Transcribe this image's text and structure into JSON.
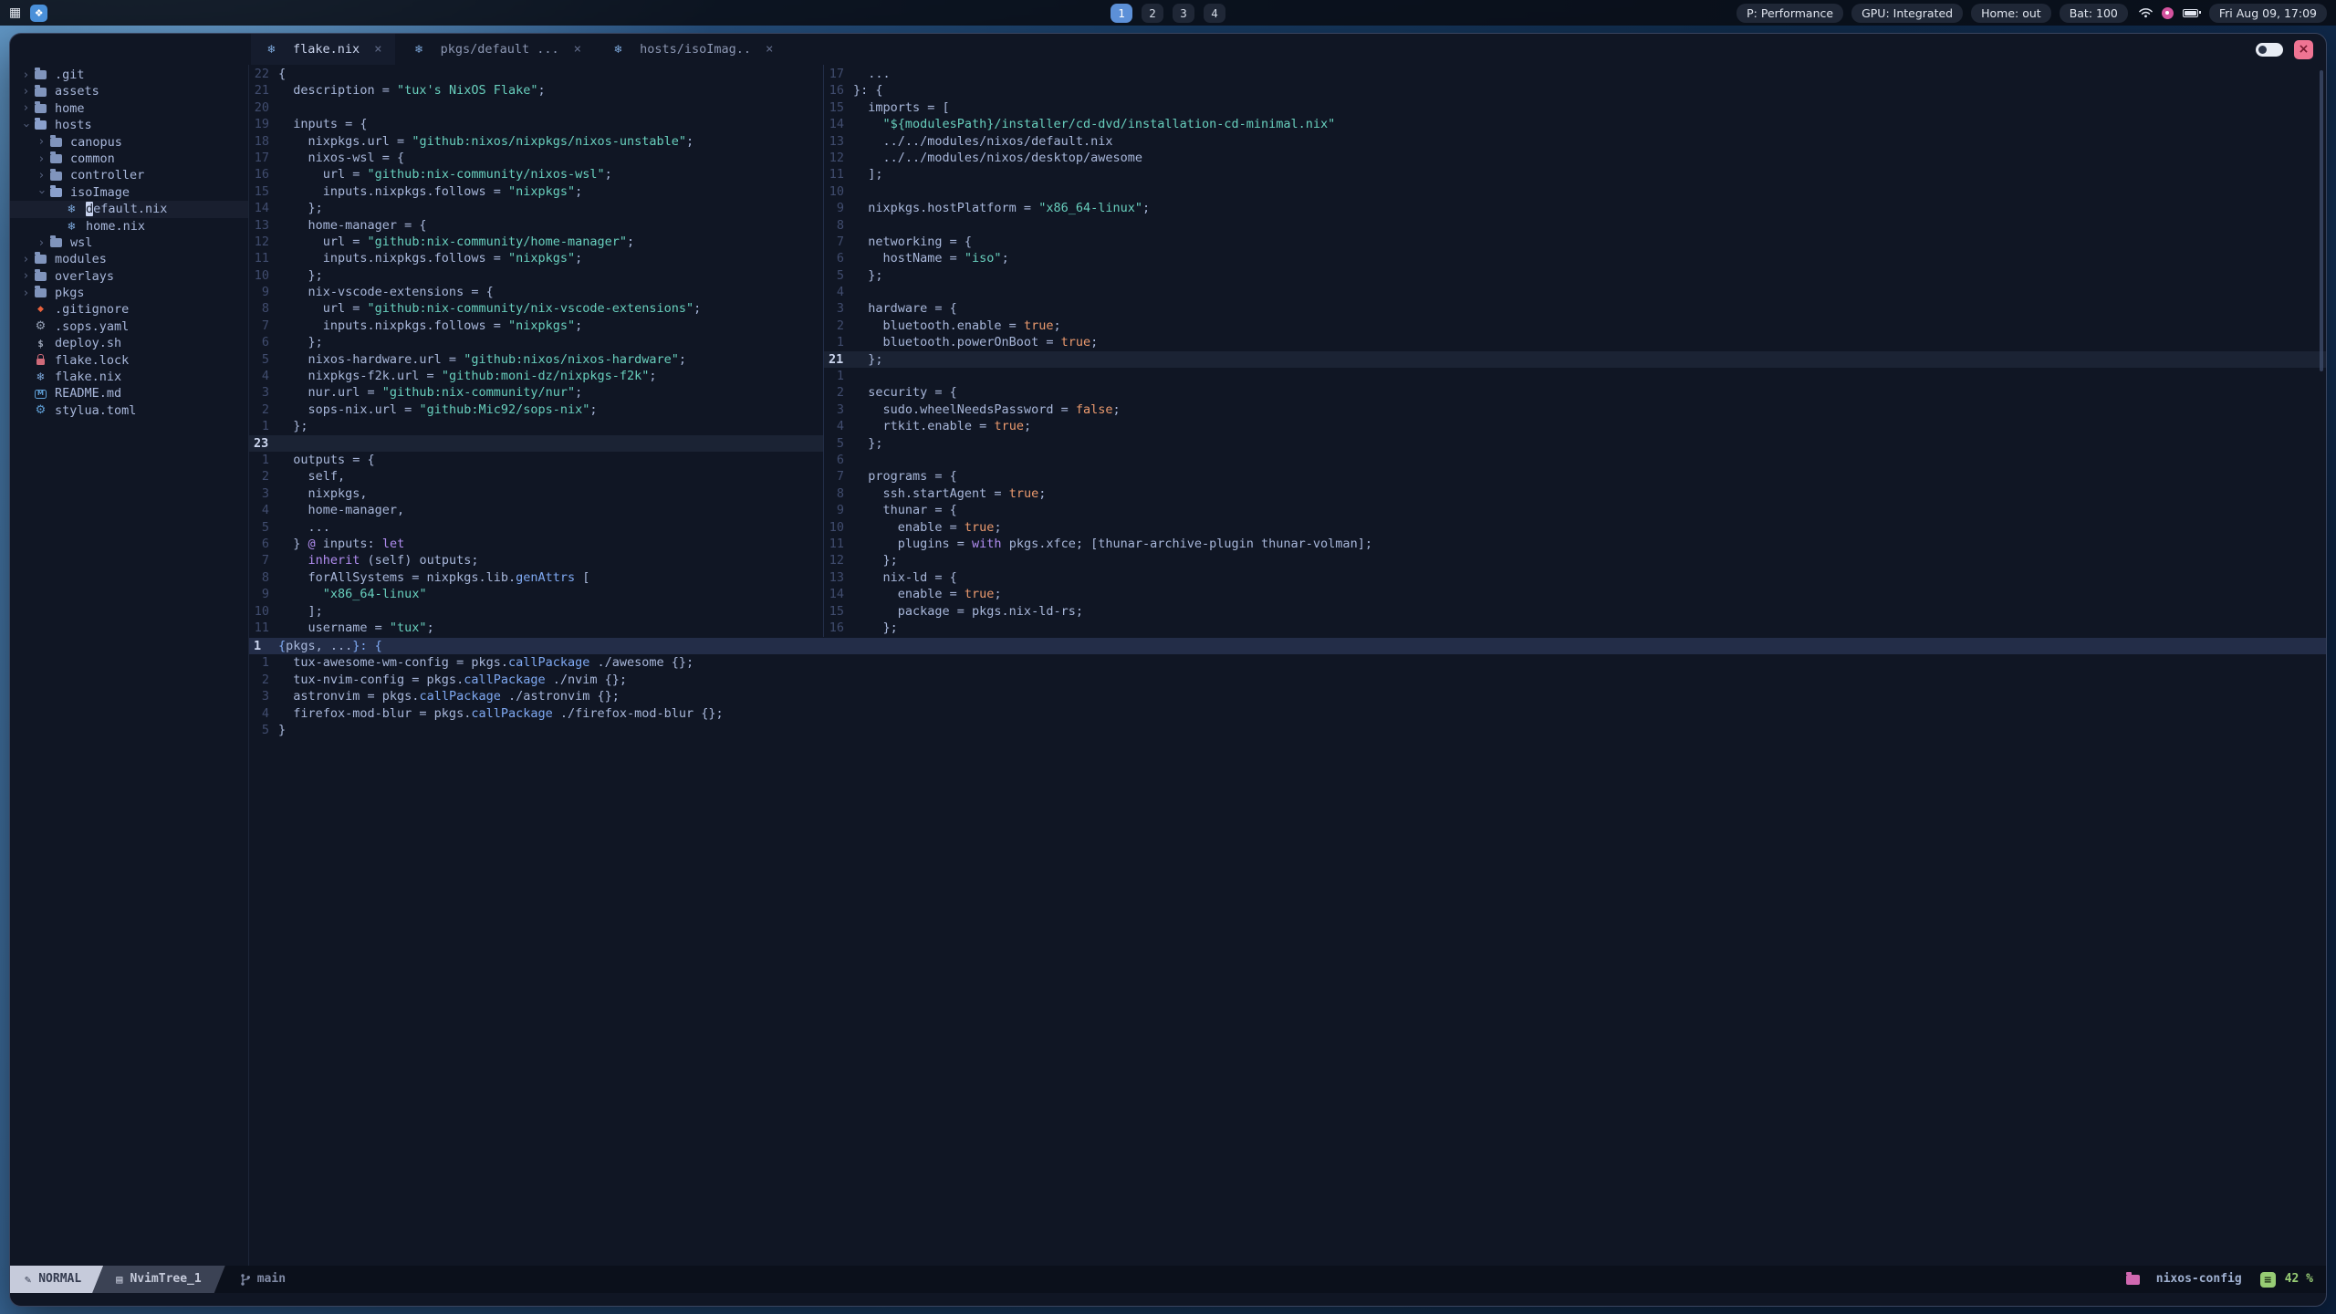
{
  "topbar": {
    "workspaces": [
      "1",
      "2",
      "3",
      "4"
    ],
    "active_workspace": "1",
    "pills": [
      "P: Performance",
      "GPU: Integrated",
      "Home: out",
      "Bat: 100"
    ],
    "clock": "Fri Aug 09, 17:09",
    "left_icons": [
      "app-grid",
      "launcher"
    ],
    "right_icons": [
      "wifi",
      "notification",
      "battery"
    ]
  },
  "window": {
    "tabs": [
      {
        "icon": "nix",
        "label": "flake.nix",
        "active": true
      },
      {
        "icon": "nix",
        "label": "pkgs/default ...",
        "active": false
      },
      {
        "icon": "nix",
        "label": "hosts/isoImag..",
        "active": false
      }
    ],
    "controls": {
      "toggle": "pin-toggle",
      "close": "×"
    }
  },
  "tree": {
    "items": [
      {
        "indent": 0,
        "chevron": "right",
        "icon": "folder",
        "label": ".git"
      },
      {
        "indent": 0,
        "chevron": "right",
        "icon": "folder",
        "label": "assets"
      },
      {
        "indent": 0,
        "chevron": "right",
        "icon": "folder",
        "label": "home"
      },
      {
        "indent": 0,
        "chevron": "down",
        "icon": "folder-open",
        "label": "hosts"
      },
      {
        "indent": 1,
        "chevron": "right",
        "icon": "folder",
        "label": "canopus"
      },
      {
        "indent": 1,
        "chevron": "right",
        "icon": "folder",
        "label": "common"
      },
      {
        "indent": 1,
        "chevron": "right",
        "icon": "folder",
        "label": "controller"
      },
      {
        "indent": 1,
        "chevron": "down",
        "icon": "folder-open",
        "label": "isoImage"
      },
      {
        "indent": 2,
        "chevron": "none",
        "icon": "nix",
        "label": "default.nix",
        "cursor": true
      },
      {
        "indent": 2,
        "chevron": "none",
        "icon": "nix",
        "label": "home.nix"
      },
      {
        "indent": 1,
        "chevron": "right",
        "icon": "folder",
        "label": "wsl"
      },
      {
        "indent": 0,
        "chevron": "right",
        "icon": "folder",
        "label": "modules"
      },
      {
        "indent": 0,
        "chevron": "right",
        "icon": "folder",
        "label": "overlays"
      },
      {
        "indent": 0,
        "chevron": "right",
        "icon": "folder",
        "label": "pkgs"
      },
      {
        "indent": 0,
        "chevron": "none",
        "icon": "git",
        "label": ".gitignore"
      },
      {
        "indent": 0,
        "chevron": "none",
        "icon": "gear",
        "label": ".sops.yaml"
      },
      {
        "indent": 0,
        "chevron": "none",
        "icon": "script",
        "label": "deploy.sh"
      },
      {
        "indent": 0,
        "chevron": "none",
        "icon": "lock",
        "label": "flake.lock"
      },
      {
        "indent": 0,
        "chevron": "none",
        "icon": "nix",
        "label": "flake.nix"
      },
      {
        "indent": 0,
        "chevron": "none",
        "icon": "markdown",
        "label": "README.md"
      },
      {
        "indent": 0,
        "chevron": "none",
        "icon": "gear-blue",
        "label": "stylua.toml"
      }
    ]
  },
  "panes": {
    "flake": {
      "lines": [
        {
          "n": "22",
          "s": [
            [
              "{",
              "f"
            ]
          ]
        },
        {
          "n": "21",
          "s": [
            [
              "  description = ",
              "f"
            ],
            [
              "\"tux's NixOS Flake\"",
              "s"
            ],
            [
              ";",
              "f"
            ]
          ]
        },
        {
          "n": "20",
          "s": []
        },
        {
          "n": "19",
          "s": [
            [
              "  inputs = {",
              "f"
            ]
          ]
        },
        {
          "n": "18",
          "s": [
            [
              "    nixpkgs.url = ",
              "f"
            ],
            [
              "\"github:nixos/nixpkgs/nixos-unstable\"",
              "s"
            ],
            [
              ";",
              "f"
            ]
          ]
        },
        {
          "n": "17",
          "s": [
            [
              "    nixos-wsl = {",
              "f"
            ]
          ]
        },
        {
          "n": "16",
          "s": [
            [
              "      url = ",
              "f"
            ],
            [
              "\"github:nix-community/nixos-wsl\"",
              "s"
            ],
            [
              ";",
              "f"
            ]
          ]
        },
        {
          "n": "15",
          "s": [
            [
              "      inputs.nixpkgs.follows = ",
              "f"
            ],
            [
              "\"nixpkgs\"",
              "s"
            ],
            [
              ";",
              "f"
            ]
          ]
        },
        {
          "n": "14",
          "s": [
            [
              "    };",
              "f"
            ]
          ]
        },
        {
          "n": "13",
          "s": [
            [
              "    home-manager = {",
              "f"
            ]
          ]
        },
        {
          "n": "12",
          "s": [
            [
              "      url = ",
              "f"
            ],
            [
              "\"github:nix-community/home-manager\"",
              "s"
            ],
            [
              ";",
              "f"
            ]
          ]
        },
        {
          "n": "11",
          "s": [
            [
              "      inputs.nixpkgs.follows = ",
              "f"
            ],
            [
              "\"nixpkgs\"",
              "s"
            ],
            [
              ";",
              "f"
            ]
          ]
        },
        {
          "n": "10",
          "s": [
            [
              "    };",
              "f"
            ]
          ]
        },
        {
          "n": "9",
          "s": [
            [
              "    nix-vscode-extensions = {",
              "f"
            ]
          ]
        },
        {
          "n": "8",
          "s": [
            [
              "      url = ",
              "f"
            ],
            [
              "\"github:nix-community/nix-vscode-extensions\"",
              "s"
            ],
            [
              ";",
              "f"
            ]
          ]
        },
        {
          "n": "7",
          "s": [
            [
              "      inputs.nixpkgs.follows = ",
              "f"
            ],
            [
              "\"nixpkgs\"",
              "s"
            ],
            [
              ";",
              "f"
            ]
          ]
        },
        {
          "n": "6",
          "s": [
            [
              "    };",
              "f"
            ]
          ]
        },
        {
          "n": "5",
          "s": [
            [
              "    nixos-hardware.url = ",
              "f"
            ],
            [
              "\"github:nixos/nixos-hardware\"",
              "s"
            ],
            [
              ";",
              "f"
            ]
          ]
        },
        {
          "n": "4",
          "s": [
            [
              "    nixpkgs-f2k.url = ",
              "f"
            ],
            [
              "\"github:moni-dz/nixpkgs-f2k\"",
              "s"
            ],
            [
              ";",
              "f"
            ]
          ]
        },
        {
          "n": "3",
          "s": [
            [
              "    nur.url = ",
              "f"
            ],
            [
              "\"github:nix-community/nur\"",
              "s"
            ],
            [
              ";",
              "f"
            ]
          ]
        },
        {
          "n": "2",
          "s": [
            [
              "    sops-nix.url = ",
              "f"
            ],
            [
              "\"github:Mic92/sops-nix\"",
              "s"
            ],
            [
              ";",
              "f"
            ]
          ]
        },
        {
          "n": "1",
          "s": [
            [
              "  };",
              "f"
            ]
          ]
        },
        {
          "n": "23",
          "cur": true,
          "s": []
        },
        {
          "n": "1",
          "s": [
            [
              "  outputs = {",
              "f"
            ]
          ]
        },
        {
          "n": "2",
          "s": [
            [
              "    self,",
              "f"
            ]
          ]
        },
        {
          "n": "3",
          "s": [
            [
              "    nixpkgs,",
              "f"
            ]
          ]
        },
        {
          "n": "4",
          "s": [
            [
              "    home-manager,",
              "f"
            ]
          ]
        },
        {
          "n": "5",
          "s": [
            [
              "    ...",
              "f"
            ]
          ]
        },
        {
          "n": "6",
          "s": [
            [
              "  } ",
              "f"
            ],
            [
              "@",
              "k"
            ],
            [
              " inputs: ",
              "f"
            ],
            [
              "let",
              "k"
            ]
          ]
        },
        {
          "n": "7",
          "s": [
            [
              "    ",
              "f"
            ],
            [
              "inherit",
              "k"
            ],
            [
              " (self) outputs;",
              "f"
            ]
          ]
        },
        {
          "n": "8",
          "s": [
            [
              "    forAllSystems = nixpkgs.lib.",
              "f"
            ],
            [
              "genAttrs",
              "u"
            ],
            [
              " [",
              "f"
            ]
          ]
        },
        {
          "n": "9",
          "s": [
            [
              "      ",
              "f"
            ],
            [
              "\"x86_64-linux\"",
              "s"
            ]
          ]
        },
        {
          "n": "10",
          "s": [
            [
              "    ];",
              "f"
            ]
          ]
        },
        {
          "n": "11",
          "s": [
            [
              "    username = ",
              "f"
            ],
            [
              "\"tux\"",
              "s"
            ],
            [
              ";",
              "f"
            ]
          ]
        }
      ]
    },
    "iso": {
      "lines": [
        {
          "n": "17",
          "s": [
            [
              "  ...",
              "f"
            ]
          ]
        },
        {
          "n": "16",
          "s": [
            [
              "}: {",
              "f"
            ]
          ]
        },
        {
          "n": "15",
          "s": [
            [
              "  imports = [",
              "f"
            ]
          ]
        },
        {
          "n": "14",
          "s": [
            [
              "    ",
              "f"
            ],
            [
              "\"${modulesPath}/installer/cd-dvd/installation-cd-minimal.nix\"",
              "s"
            ]
          ]
        },
        {
          "n": "13",
          "s": [
            [
              "    ../../modules/nixos/default.nix",
              "f"
            ]
          ]
        },
        {
          "n": "12",
          "s": [
            [
              "    ../../modules/nixos/desktop/awesome",
              "f"
            ]
          ]
        },
        {
          "n": "11",
          "s": [
            [
              "  ];",
              "f"
            ]
          ]
        },
        {
          "n": "10",
          "s": []
        },
        {
          "n": "9",
          "s": [
            [
              "  nixpkgs.hostPlatform = ",
              "f"
            ],
            [
              "\"x86_64-linux\"",
              "s"
            ],
            [
              ";",
              "f"
            ]
          ]
        },
        {
          "n": "8",
          "s": []
        },
        {
          "n": "7",
          "s": [
            [
              "  networking = {",
              "f"
            ]
          ]
        },
        {
          "n": "6",
          "s": [
            [
              "    hostName = ",
              "f"
            ],
            [
              "\"iso\"",
              "s"
            ],
            [
              ";",
              "f"
            ]
          ]
        },
        {
          "n": "5",
          "s": [
            [
              "  };",
              "f"
            ]
          ]
        },
        {
          "n": "4",
          "s": []
        },
        {
          "n": "3",
          "s": [
            [
              "  hardware = {",
              "f"
            ]
          ]
        },
        {
          "n": "2",
          "s": [
            [
              "    bluetooth.enable = ",
              "f"
            ],
            [
              "true",
              "b"
            ],
            [
              ";",
              "f"
            ]
          ]
        },
        {
          "n": "1",
          "s": [
            [
              "    bluetooth.powerOnBoot = ",
              "f"
            ],
            [
              "true",
              "b"
            ],
            [
              ";",
              "f"
            ]
          ]
        },
        {
          "n": "21",
          "cur": true,
          "s": [
            [
              "  };",
              "f"
            ]
          ]
        },
        {
          "n": "1",
          "s": []
        },
        {
          "n": "2",
          "s": [
            [
              "  security = {",
              "f"
            ]
          ]
        },
        {
          "n": "3",
          "s": [
            [
              "    sudo.wheelNeedsPassword = ",
              "f"
            ],
            [
              "false",
              "b"
            ],
            [
              ";",
              "f"
            ]
          ]
        },
        {
          "n": "4",
          "s": [
            [
              "    rtkit.enable = ",
              "f"
            ],
            [
              "true",
              "b"
            ],
            [
              ";",
              "f"
            ]
          ]
        },
        {
          "n": "5",
          "s": [
            [
              "  };",
              "f"
            ]
          ]
        },
        {
          "n": "6",
          "s": []
        },
        {
          "n": "7",
          "s": [
            [
              "  programs = {",
              "f"
            ]
          ]
        },
        {
          "n": "8",
          "s": [
            [
              "    ssh.startAgent = ",
              "f"
            ],
            [
              "true",
              "b"
            ],
            [
              ";",
              "f"
            ]
          ]
        },
        {
          "n": "9",
          "s": [
            [
              "    thunar = {",
              "f"
            ]
          ]
        },
        {
          "n": "10",
          "s": [
            [
              "      enable = ",
              "f"
            ],
            [
              "true",
              "b"
            ],
            [
              ";",
              "f"
            ]
          ]
        },
        {
          "n": "11",
          "s": [
            [
              "      plugins = ",
              "f"
            ],
            [
              "with",
              "k"
            ],
            [
              " pkgs.xfce; [thunar-archive-plugin thunar-volman];",
              "f"
            ]
          ]
        },
        {
          "n": "12",
          "s": [
            [
              "    };",
              "f"
            ]
          ]
        },
        {
          "n": "13",
          "s": [
            [
              "    nix-ld = {",
              "f"
            ]
          ]
        },
        {
          "n": "14",
          "s": [
            [
              "      enable = ",
              "f"
            ],
            [
              "true",
              "b"
            ],
            [
              ";",
              "f"
            ]
          ]
        },
        {
          "n": "15",
          "s": [
            [
              "      package = pkgs.nix-ld-rs;",
              "f"
            ]
          ]
        },
        {
          "n": "16",
          "s": [
            [
              "    };",
              "f"
            ]
          ]
        }
      ]
    },
    "pkgs": {
      "lines": [
        {
          "n": "1",
          "cur": true,
          "s": [
            [
              "{",
              "u"
            ],
            [
              "pkgs, ...",
              "f"
            ],
            [
              "}: {",
              "u"
            ]
          ]
        },
        {
          "n": "1",
          "s": [
            [
              "  tux-awesome-wm-config = pkgs.",
              "f"
            ],
            [
              "callPackage",
              "u"
            ],
            [
              " ./awesome {};",
              "f"
            ]
          ]
        },
        {
          "n": "2",
          "s": [
            [
              "  tux-nvim-config = pkgs.",
              "f"
            ],
            [
              "callPackage",
              "u"
            ],
            [
              " ./nvim {};",
              "f"
            ]
          ]
        },
        {
          "n": "3",
          "s": [
            [
              "  astronvim = pkgs.",
              "f"
            ],
            [
              "callPackage",
              "u"
            ],
            [
              " ./astronvim {};",
              "f"
            ]
          ]
        },
        {
          "n": "4",
          "s": [
            [
              "  firefox-mod-blur = pkgs.",
              "f"
            ],
            [
              "callPackage",
              "u"
            ],
            [
              " ./firefox-mod-blur {};",
              "f"
            ]
          ]
        },
        {
          "n": "5",
          "s": [
            [
              "}",
              "f"
            ]
          ]
        }
      ]
    }
  },
  "statusline": {
    "mode": "NORMAL",
    "buffer": "NvimTree_1",
    "branch": "main",
    "project": "nixos-config",
    "scroll": "42 %"
  },
  "colors": {
    "accent_blue": "#5c90d8",
    "string_teal": "#68cfbd",
    "boolean_orange": "#eb9a6e",
    "keyword_purple": "#b18df0",
    "function_blue": "#7fa9f2",
    "close_pink": "#ef7493",
    "project_pink": "#d068b0",
    "scroll_green": "#97cc74",
    "window_bg": "#101624"
  }
}
